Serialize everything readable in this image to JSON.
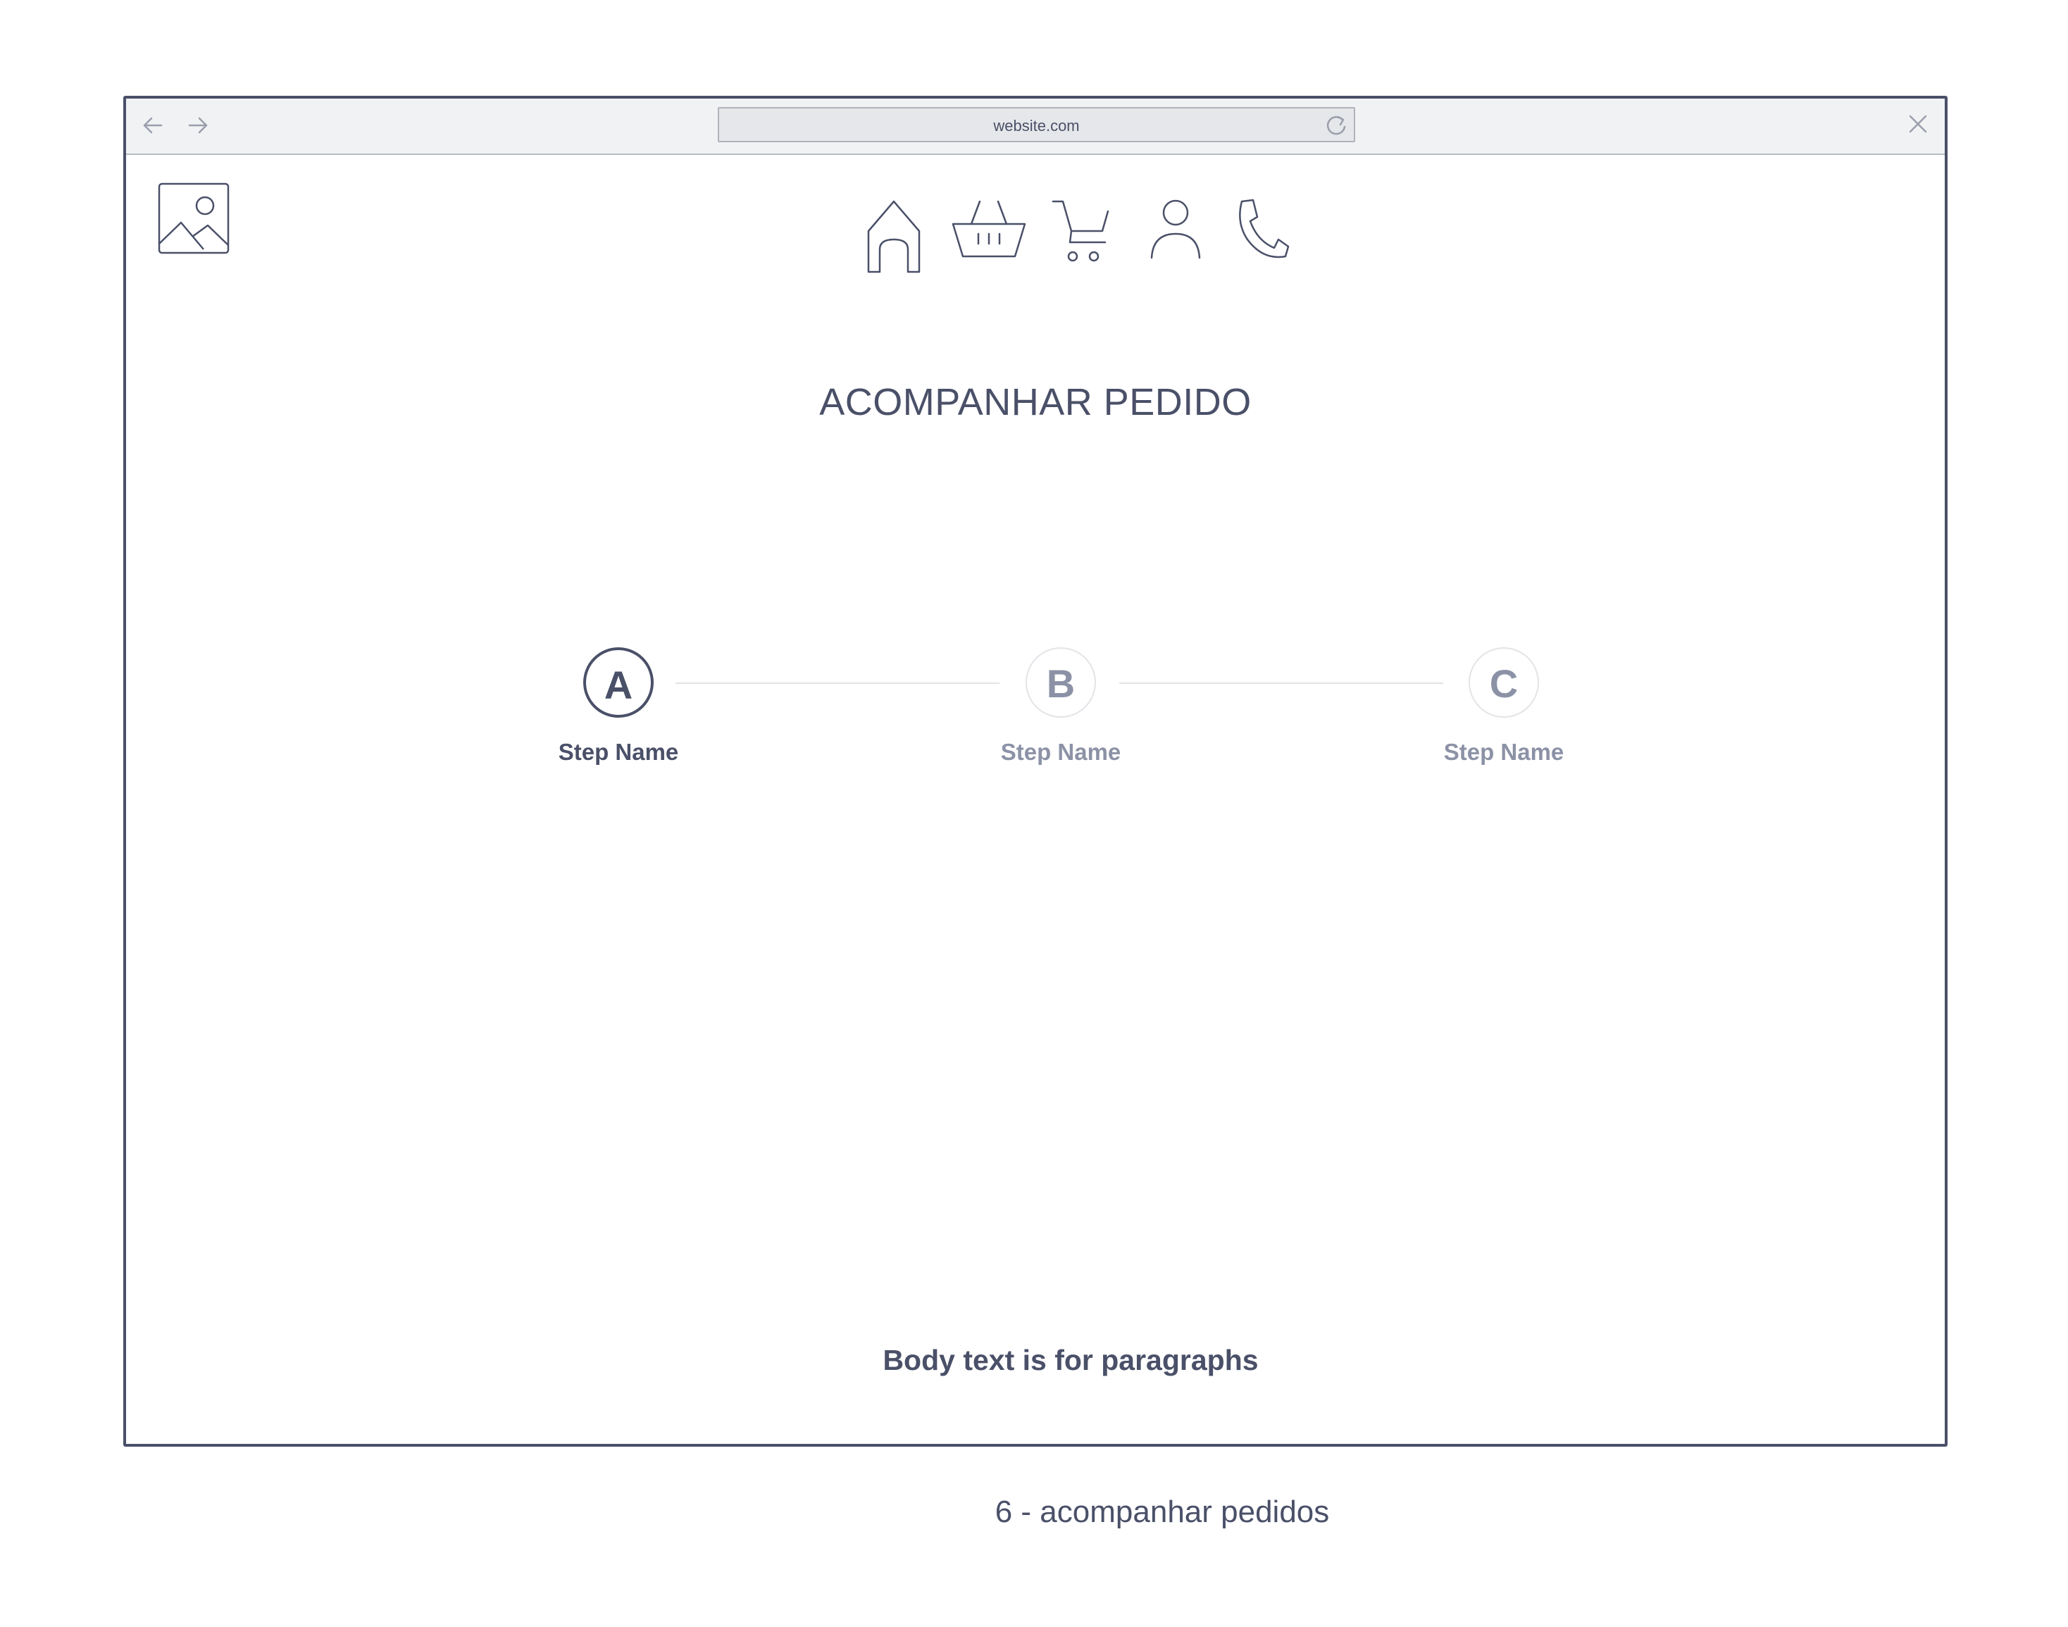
{
  "browser": {
    "url": "website.com"
  },
  "nav_icons": [
    "home-icon",
    "basket-icon",
    "cart-icon",
    "user-icon",
    "phone-icon"
  ],
  "page": {
    "title": "ACOMPANHAR PEDIDO",
    "body_text": "Body text is for paragraphs"
  },
  "stepper": {
    "steps": [
      {
        "letter": "A",
        "label": "Step Name",
        "state": "active"
      },
      {
        "letter": "B",
        "label": "Step Name",
        "state": "inactive"
      },
      {
        "letter": "C",
        "label": "Step Name",
        "state": "inactive"
      }
    ]
  },
  "caption": "6 - acompanhar pedidos",
  "colors": {
    "ink": "#4a5068",
    "muted": "#8c92a6",
    "chrome_bg": "#f1f2f4"
  }
}
